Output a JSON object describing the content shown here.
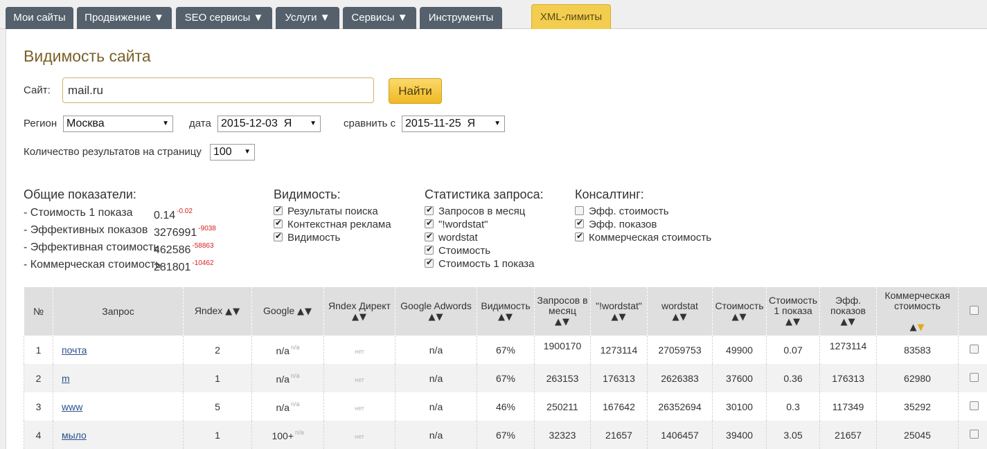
{
  "nav": {
    "tabs": [
      "Мои сайты",
      "Продвижение ▼",
      "SEO сервисы ▼",
      "Услуги ▼",
      "Сервисы ▼",
      "Инструменты"
    ],
    "xml_tab": "XML-лимиты"
  },
  "page_title": "Видимость сайта",
  "site": {
    "label": "Сайт:",
    "value": "mail.ru",
    "button": "Найти"
  },
  "filters": {
    "region_label": "Регион",
    "region_value": "Москва",
    "date_label": "дата",
    "date_value": "2015-12-03  Я",
    "compare_label": "сравнить с",
    "compare_value": "2015-11-25  Я",
    "perpage_label": "Количество результатов на страницу",
    "perpage_value": "100"
  },
  "general": {
    "title": "Общие показатели:",
    "rows": [
      {
        "label": "- Стоимость 1 показа",
        "value": "0.14",
        "delta": "-0.02"
      },
      {
        "label": "- Эффективных показов",
        "value": "3276991",
        "delta": "-9038"
      },
      {
        "label": "- Эффективная стоимость",
        "value": "462586",
        "delta": "-58863"
      },
      {
        "label": "- Коммерческая стоимость",
        "value": "281801",
        "delta": "-10462"
      }
    ]
  },
  "visibility": {
    "title": "Видимость:",
    "items": [
      {
        "label": "Результаты поиска",
        "checked": true
      },
      {
        "label": "Контекстная реклама",
        "checked": true
      },
      {
        "label": "Видимость",
        "checked": true
      }
    ]
  },
  "stats": {
    "title": "Статистика запроса:",
    "items": [
      {
        "label": "Запросов в месяц",
        "checked": true
      },
      {
        "label": "\"!wordstat\"",
        "checked": true
      },
      {
        "label": "wordstat",
        "checked": true
      },
      {
        "label": "Стоимость",
        "checked": true
      },
      {
        "label": "Стоимость 1 показа",
        "checked": true
      }
    ]
  },
  "consulting": {
    "title": "Консалтинг:",
    "items": [
      {
        "label": "Эфф. стоимость",
        "checked": false
      },
      {
        "label": "Эфф. показов",
        "checked": true
      },
      {
        "label": "Коммерческая стоимость",
        "checked": true
      }
    ]
  },
  "table": {
    "headers": {
      "num": "№",
      "query": "Запрос",
      "yandex": "Яndex",
      "google": "Google",
      "direct": "Яndex Директ",
      "adwords": "Google Adwords",
      "visibility": "Видимость",
      "requests": "Запросов в месяц",
      "wordstat_exact": "\"!wordstat\"",
      "wordstat": "wordstat",
      "cost": "Стоимость",
      "cost1": "Стоимость 1 показа",
      "eff_shows": "Эфф. показов",
      "commercial": "Коммерческая стоимость"
    },
    "rows": [
      {
        "num": "1",
        "query": "почта",
        "yandex": "2",
        "google": "n/a",
        "google_delta": "n/a",
        "direct": "нет",
        "adwords": "n/a",
        "visibility": "67%",
        "requests": "1900170",
        "wordstat_exact": "1273114",
        "wordstat": "27059753",
        "cost": "49900",
        "cost1": "0.07",
        "eff_shows": "1273114",
        "commercial": "83583"
      },
      {
        "num": "2",
        "query": "m",
        "yandex": "1",
        "google": "n/a",
        "google_delta": "n/a",
        "direct": "нет",
        "adwords": "n/a",
        "visibility": "67%",
        "requests": "263153",
        "wordstat_exact": "176313",
        "wordstat": "2626383",
        "cost": "37600",
        "cost1": "0.36",
        "eff_shows": "176313",
        "commercial": "62980"
      },
      {
        "num": "3",
        "query": "www",
        "yandex": "5",
        "google": "n/a",
        "google_delta": "n/a",
        "direct": "нет",
        "adwords": "n/a",
        "visibility": "46%",
        "requests": "250211",
        "wordstat_exact": "167642",
        "wordstat": "26352694",
        "cost": "30100",
        "cost1": "0.3",
        "eff_shows": "117349",
        "commercial": "35292"
      },
      {
        "num": "4",
        "query": "мыло",
        "yandex": "1",
        "google": "100+",
        "google_delta": "n/a",
        "direct": "нет",
        "adwords": "n/a",
        "visibility": "67%",
        "requests": "32323",
        "wordstat_exact": "21657",
        "wordstat": "1406457",
        "cost": "39400",
        "cost1": "3.05",
        "eff_shows": "21657",
        "commercial": "25045"
      }
    ]
  },
  "colors": {
    "nav_tab": "#54606b",
    "xml_tab": "#f3cd4f",
    "title": "#7a6128",
    "delta": "#d42020",
    "sort_active": "#e5a91a",
    "link": "#2a4f8c"
  }
}
